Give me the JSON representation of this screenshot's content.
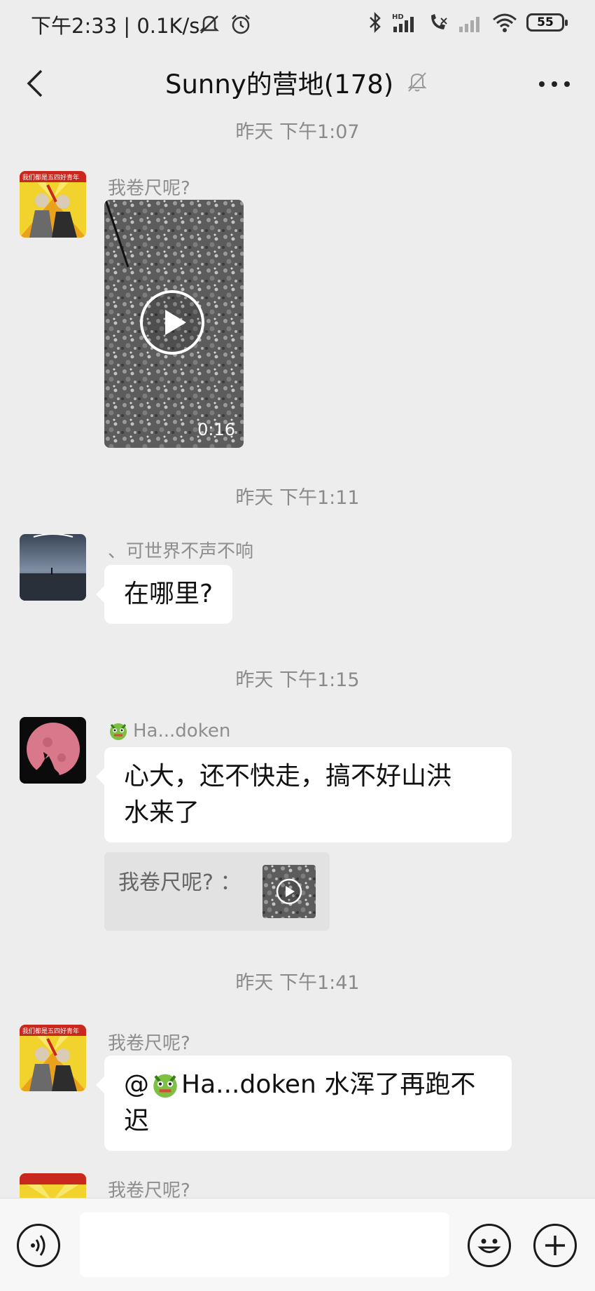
{
  "status_bar": {
    "time": "下午2:33",
    "speed": "0.1K/s",
    "battery": "55",
    "icons": [
      "mute-icon",
      "alarm-icon",
      "bluetooth-icon",
      "hd-signal-icon",
      "call-forward-icon",
      "signal-icon",
      "wifi-icon",
      "battery-icon"
    ]
  },
  "header": {
    "title": "Sunny的营地(178)",
    "back_icon": "chevron-left-icon",
    "mute_icon": "bell-off-icon",
    "more_icon": "ellipsis-icon"
  },
  "messages": [
    {
      "time": "昨天  下午1:07",
      "sender": "我卷尺呢?",
      "type": "video",
      "duration": "0:16"
    },
    {
      "time": "昨天  下午1:11",
      "sender": "、可世界不声不响",
      "type": "text",
      "text": "在哪里?"
    },
    {
      "time": "昨天  下午1:15",
      "sender": "Ha...doken",
      "type": "text",
      "text_line1": "心大，还不快走，搞不好山洪",
      "text_line2": "水来了",
      "quote": "我卷尺呢? ："
    },
    {
      "time": "昨天  下午1:41",
      "sender": "我卷尺呢?",
      "type": "text",
      "mention": "@",
      "mention_name": "Ha...doken",
      "text_line1_rest": " 水浑了再跑不",
      "text_line2": "迟"
    },
    {
      "sender": "我卷尺呢?"
    }
  ],
  "input_bar": {
    "voice_icon": "voice-icon",
    "emoji_icon": "emoji-icon",
    "plus_icon": "plus-icon",
    "placeholder": ""
  },
  "colors": {
    "background": "#ededed",
    "bubble": "#ffffff",
    "timestamp": "#8a8a8a",
    "sender": "#8e8e8e"
  }
}
